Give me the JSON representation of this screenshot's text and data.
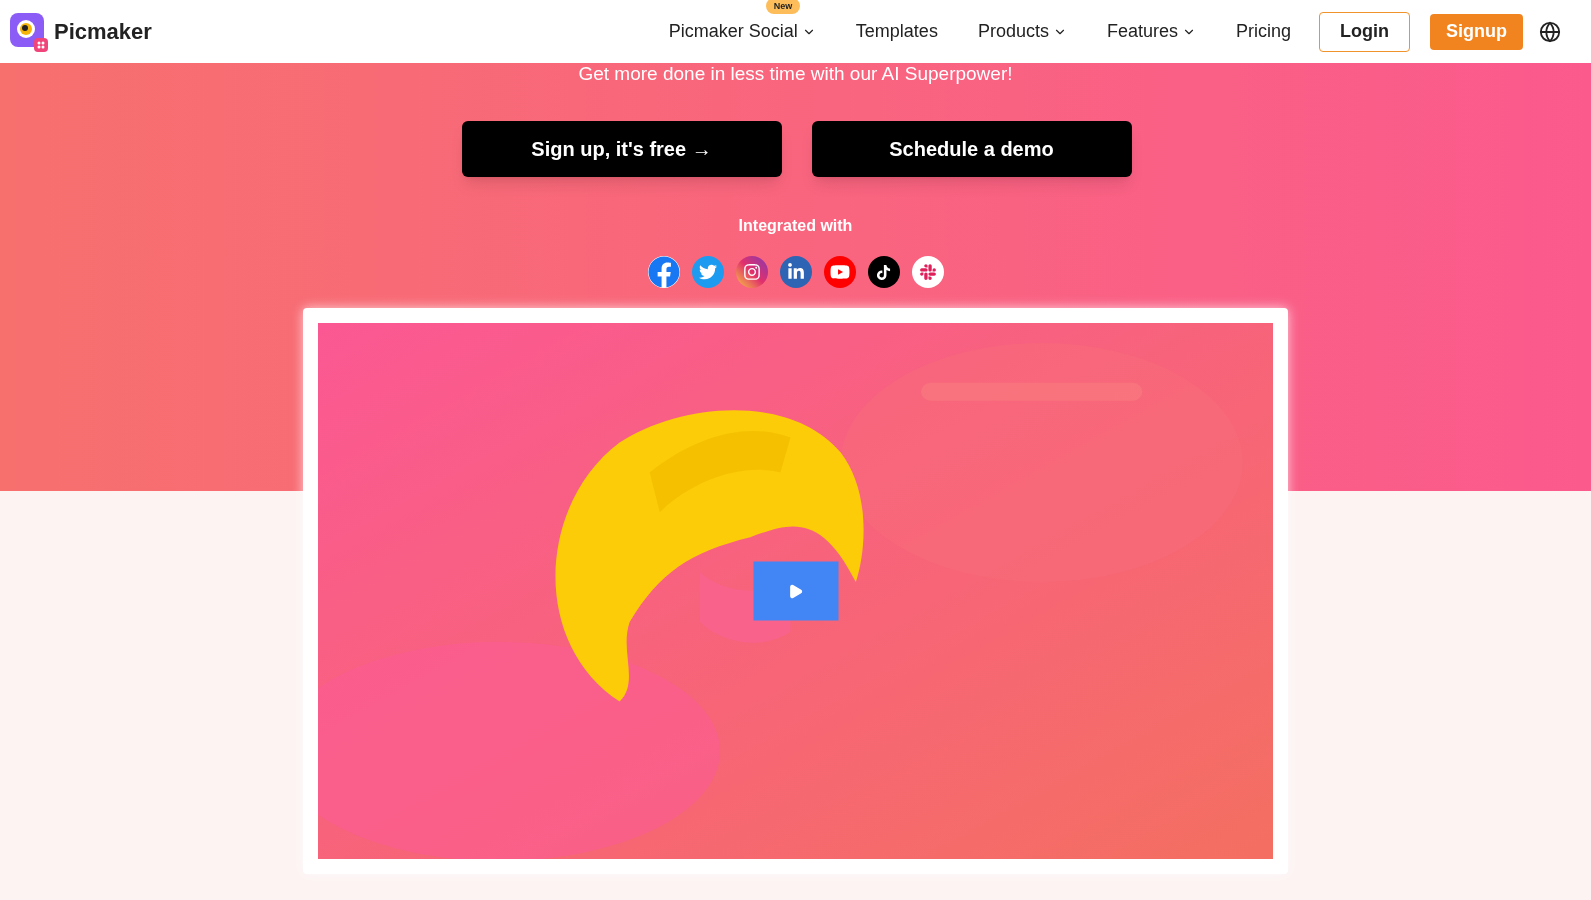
{
  "header": {
    "brand": "Picmaker",
    "nav": [
      {
        "label": "Picmaker Social",
        "dropdown": true,
        "badge": "New"
      },
      {
        "label": "Templates",
        "dropdown": false
      },
      {
        "label": "Products",
        "dropdown": true
      },
      {
        "label": "Features",
        "dropdown": true
      },
      {
        "label": "Pricing",
        "dropdown": false
      }
    ],
    "login": "Login",
    "signup": "Signup"
  },
  "hero": {
    "subtitle": "Get more done in less time with our AI Superpower!",
    "buttons": [
      "Sign up, it's free →",
      "Schedule a demo"
    ],
    "integrated_label": "Integrated with",
    "integrations": [
      {
        "kind": "facebook"
      },
      {
        "kind": "twitter"
      },
      {
        "kind": "instagram"
      },
      {
        "kind": "linkedin"
      },
      {
        "kind": "youtube"
      },
      {
        "kind": "tiktok"
      },
      {
        "kind": "slack"
      }
    ]
  }
}
